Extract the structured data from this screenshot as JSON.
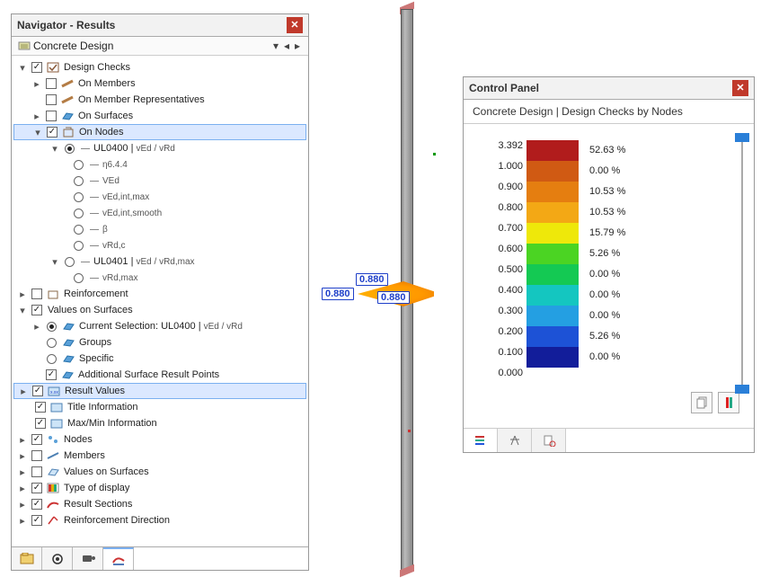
{
  "navigator": {
    "title": "Navigator - Results",
    "subtitle": "Concrete Design",
    "tree": {
      "design_checks": "Design Checks",
      "on_members": "On Members",
      "on_member_reps": "On Member Representatives",
      "on_surfaces": "On Surfaces",
      "on_nodes": "On Nodes",
      "ul0400": "UL0400 |",
      "ul0400_sub": "vEd / vRd",
      "eta": "η6.4.4",
      "ved": "VEd",
      "ved_int_max": "vEd,int,max",
      "ved_int_smooth": "vEd,int,smooth",
      "beta": "β",
      "vrdc": "vRd,c",
      "ul0401": "UL0401 |",
      "ul0401_sub": "vEd / vRd,max",
      "vrd_max": "vRd,max",
      "reinforcement": "Reinforcement",
      "values_on_surfaces": "Values on Surfaces",
      "cur_sel": "Current Selection: UL0400 |",
      "cur_sel_sub": "vEd / vRd",
      "groups": "Groups",
      "specific": "Specific",
      "additional_pts": "Additional Surface Result Points",
      "result_values": "Result Values",
      "title_info": "Title Information",
      "maxmin": "Max/Min Information",
      "nodes": "Nodes",
      "members": "Members",
      "vos2": "Values on Surfaces",
      "type_display": "Type of display",
      "result_sections": "Result Sections",
      "reinf_dir": "Reinforcement Direction"
    }
  },
  "callouts": {
    "a": "0.880",
    "b": "0.880",
    "c": "0.880"
  },
  "control": {
    "title": "Control Panel",
    "subtitle": "Concrete Design | Design Checks by Nodes"
  },
  "chart_data": {
    "type": "table",
    "title": "Design Checks by Nodes — color scale",
    "rows": [
      {
        "value": "3.392",
        "color": "#b11c1c",
        "pct": "52.63 %"
      },
      {
        "value": "1.000",
        "color": "#d05a13",
        "pct": "0.00 %"
      },
      {
        "value": "0.900",
        "color": "#e57e10",
        "pct": "10.53 %"
      },
      {
        "value": "0.800",
        "color": "#f3a815",
        "pct": "10.53 %"
      },
      {
        "value": "0.700",
        "color": "#eee80a",
        "pct": "15.79 %"
      },
      {
        "value": "0.600",
        "color": "#4bd423",
        "pct": "5.26 %"
      },
      {
        "value": "0.500",
        "color": "#14c953",
        "pct": "0.00 %"
      },
      {
        "value": "0.400",
        "color": "#14c6c0",
        "pct": "0.00 %"
      },
      {
        "value": "0.300",
        "color": "#249fe2",
        "pct": "0.00 %"
      },
      {
        "value": "0.200",
        "color": "#1d52d6",
        "pct": "5.26 %"
      },
      {
        "value": "0.100",
        "color": "#121d9a",
        "pct": "0.00 %"
      },
      {
        "value": "0.000",
        "color": "",
        "pct": ""
      }
    ]
  }
}
